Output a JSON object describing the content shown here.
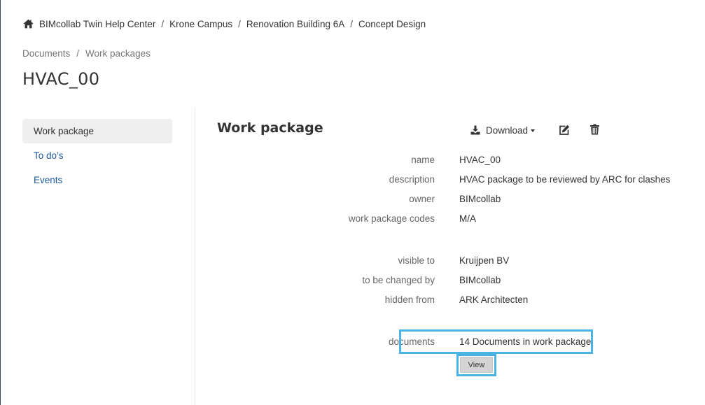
{
  "breadcrumb": {
    "home_icon": "home-icon",
    "items": [
      "BIMcollab Twin Help Center",
      "Krone Campus",
      "Renovation Building 6A",
      "Concept Design"
    ],
    "separator": "/"
  },
  "subcrumb": {
    "items": [
      "Documents",
      "Work packages"
    ],
    "separator": "/"
  },
  "page": {
    "title": "HVAC_00"
  },
  "sidebar": {
    "items": [
      {
        "label": "Work package",
        "active": true
      },
      {
        "label": "To do’s",
        "active": false
      },
      {
        "label": "Events",
        "active": false
      }
    ]
  },
  "main": {
    "title": "Work package",
    "actions": {
      "download_label": "Download",
      "download_icon": "download-icon",
      "edit_icon": "edit-icon",
      "delete_icon": "trash-icon"
    },
    "fields": [
      {
        "label": "name",
        "value": "HVAC_00"
      },
      {
        "label": "description",
        "value": "HVAC package to be reviewed by ARC for clashes"
      },
      {
        "label": "owner",
        "value": "BIMcollab"
      },
      {
        "label": "work package codes",
        "value": "M/A"
      },
      {
        "label": "visible to",
        "value": "Kruijpen BV"
      },
      {
        "label": "to be changed by",
        "value": "BIMcollab"
      },
      {
        "label": "hidden from",
        "value": "ARK Architecten"
      },
      {
        "label": "documents",
        "value": "14 Documents in work package"
      }
    ],
    "view_label": "View",
    "highlight_color": "#4ab3e6"
  }
}
